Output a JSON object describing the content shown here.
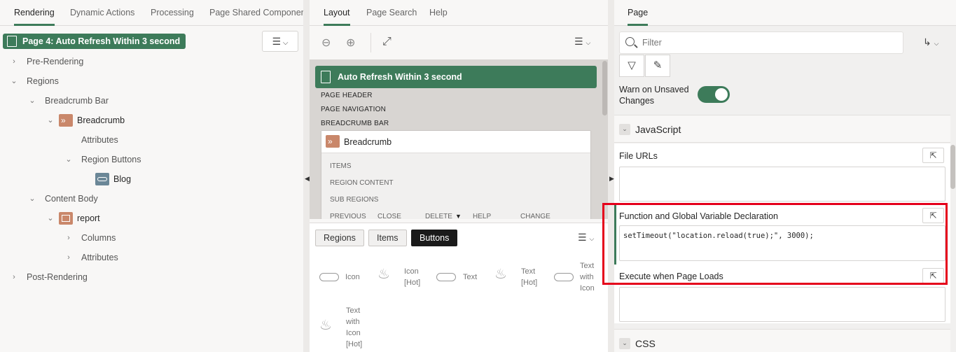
{
  "left_panel": {
    "tabs": [
      {
        "label": "Rendering",
        "active": true
      },
      {
        "label": "Dynamic Actions"
      },
      {
        "label": "Processing"
      },
      {
        "label": "Page Shared Component"
      }
    ],
    "selected_page": "Page 4: Auto Refresh Within 3 second",
    "tree": {
      "pre_rendering": "Pre-Rendering",
      "regions": "Regions",
      "breadcrumb_bar": "Breadcrumb Bar",
      "breadcrumb": "Breadcrumb",
      "attributes_1": "Attributes",
      "region_buttons": "Region Buttons",
      "blog": "Blog",
      "content_body": "Content Body",
      "report": "report",
      "columns": "Columns",
      "attributes_2": "Attributes",
      "post_rendering": "Post-Rendering"
    }
  },
  "middle_panel": {
    "tabs": [
      {
        "label": "Layout",
        "active": true
      },
      {
        "label": "Page Search"
      },
      {
        "label": "Help"
      }
    ],
    "page_bar_title": "Auto Refresh Within 3 second",
    "labels": {
      "page_header": "PAGE HEADER",
      "page_navigation": "PAGE NAVIGATION",
      "breadcrumb_bar": "BREADCRUMB BAR"
    },
    "breadcrumb_region": {
      "title": "Breadcrumb",
      "items": "ITEMS",
      "region_content": "REGION CONTENT",
      "sub_regions": "SUB REGIONS",
      "positions": [
        "PREVIOUS",
        "CLOSE",
        "DELETE",
        "HELP",
        "CHANGE"
      ]
    },
    "gallery": {
      "tabs": [
        {
          "label": "Regions"
        },
        {
          "label": "Items"
        },
        {
          "label": "Buttons",
          "active": true
        }
      ],
      "items": {
        "icon": "Icon",
        "icon_hot_1": "Icon",
        "icon_hot_2": "[Hot]",
        "text": "Text",
        "text_hot_1": "Text",
        "text_hot_2": "[Hot]",
        "text_with_icon_1": "Text",
        "text_with_icon_2": "with",
        "text_with_icon_3": "Icon",
        "text_with_icon_hot_1": "Text",
        "text_with_icon_hot_2": "with",
        "text_with_icon_hot_3": "Icon",
        "text_with_icon_hot_4": "[Hot]"
      }
    }
  },
  "right_panel": {
    "tab": "Page",
    "filter_placeholder": "Filter",
    "warn_unsaved_label_1": "Warn on Unsaved",
    "warn_unsaved_label_2": "Changes",
    "warn_unsaved_on": true,
    "javascript_section": "JavaScript",
    "file_urls_label": "File URLs",
    "function_decl_label": "Function and Global Variable Declaration",
    "function_decl_value": "setTimeout(\"location.reload(true);\", 3000);",
    "execute_on_load_label": "Execute when Page Loads",
    "css_section": "CSS"
  },
  "colors": {
    "accent_green": "#3d7b5a",
    "highlight_red": "#e5001b",
    "node_orange": "#c9876a",
    "node_slate": "#6b8797"
  }
}
